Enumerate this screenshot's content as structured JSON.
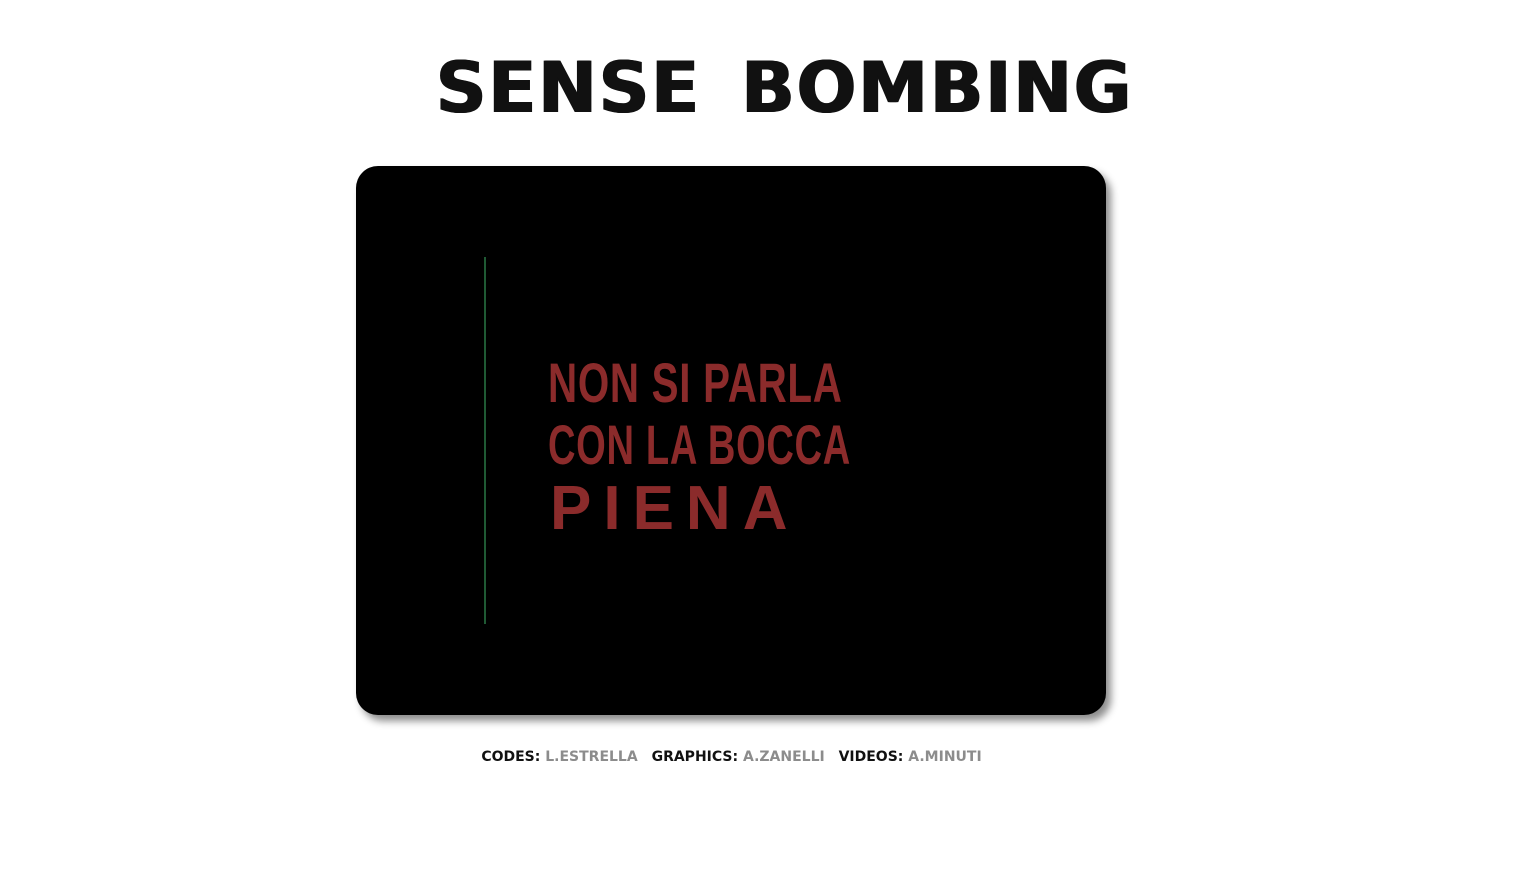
{
  "header": {
    "title": "SENSE BOMBING"
  },
  "player": {
    "frame_text": {
      "line1": "NON SI PARLA",
      "line2": "CON LA BOCCA",
      "line3": "PIENA"
    }
  },
  "credits": {
    "codes_label": "CODES:",
    "codes_name": "L.ESTRELLA",
    "graphics_label": "GRAPHICS:",
    "graphics_name": "A.ZANELLI",
    "videos_label": "VIDEOS:",
    "videos_name": "A.MINUTI"
  },
  "colors": {
    "background": "#ffffff",
    "player_background": "#000000",
    "frame_text": "#8b2b2b",
    "playhead_line": "#1f5a34",
    "credit_label": "#111111",
    "credit_name": "#8c8c8c"
  }
}
